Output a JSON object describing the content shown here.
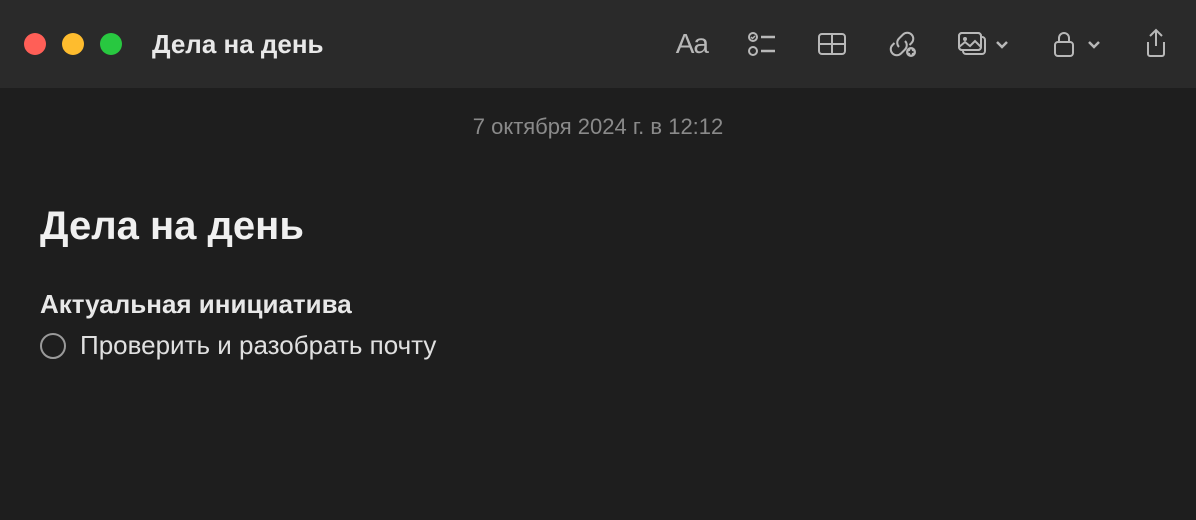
{
  "window": {
    "title": "Дела на день"
  },
  "note": {
    "timestamp": "7 октября 2024 г. в 12:12",
    "title": "Дела на день",
    "section_heading": "Актуальная инициатива",
    "checklist": [
      {
        "text": "Проверить и разобрать почту",
        "checked": false
      }
    ]
  }
}
